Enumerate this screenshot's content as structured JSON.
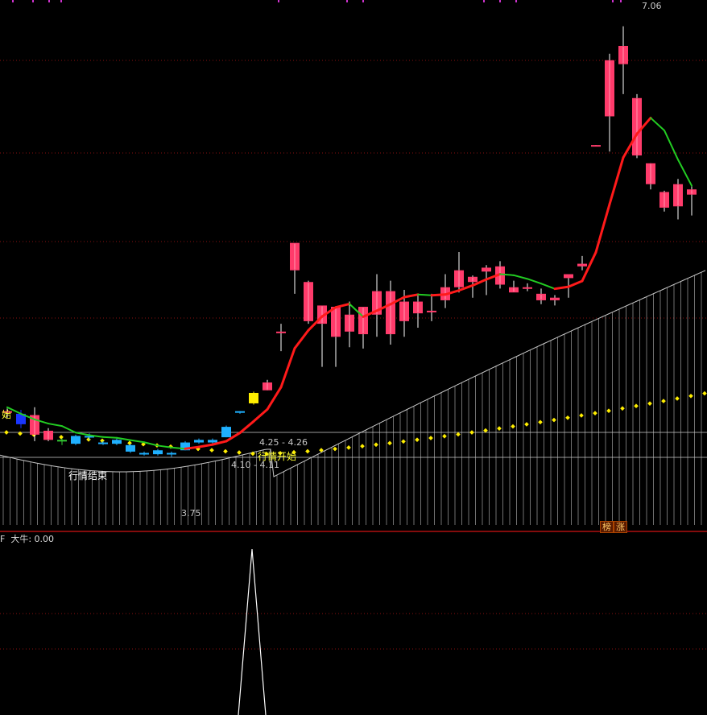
{
  "colors": {
    "background": "#000000",
    "grid": "#8a1010",
    "up_candle": "#ff3b6b",
    "down_candle": "#1fb0ff",
    "signal_up": "#ffee00",
    "signal_down": "#1a36ff",
    "green_candle": "#33cc33",
    "ma_rising": "#ff1a1a",
    "ma_falling": "#22cc22",
    "dots": "#ffee00",
    "envelope": "#c8c8c8",
    "indicator": "#ffffff"
  },
  "annotations": {
    "high_price": "7.06",
    "low_price": "3.75",
    "range_upper": "4.25 - 4.26",
    "range_lower": "4.10 - 4.11",
    "trend_end": "行情结束",
    "trend_start": "行情开始",
    "left_cut": "始",
    "badge_a": "榜",
    "badge_b": "涨"
  },
  "indicator": {
    "prefix": "F",
    "name": "大牛",
    "value": "0.00"
  },
  "chart_data": {
    "type": "candlestick",
    "ylim": [
      3.25,
      7.2
    ],
    "candles": [
      {
        "o": 4.1,
        "h": 4.13,
        "l": 4.06,
        "c": 4.11,
        "kind": "up"
      },
      {
        "o": 4.09,
        "h": 4.12,
        "l": 3.98,
        "c": 4.01,
        "kind": "signal_down"
      },
      {
        "o": 4.08,
        "h": 4.14,
        "l": 3.88,
        "c": 3.93,
        "kind": "up"
      },
      {
        "o": 3.96,
        "h": 3.98,
        "l": 3.88,
        "c": 3.89,
        "kind": "up"
      },
      {
        "o": 3.88,
        "h": 3.9,
        "l": 3.85,
        "c": 3.89,
        "kind": "green"
      },
      {
        "o": 3.92,
        "h": 3.93,
        "l": 3.85,
        "c": 3.86,
        "kind": "down"
      },
      {
        "o": 3.92,
        "h": 3.94,
        "l": 3.89,
        "c": 3.91,
        "kind": "down"
      },
      {
        "o": 3.87,
        "h": 3.88,
        "l": 3.85,
        "c": 3.86,
        "kind": "down"
      },
      {
        "o": 3.89,
        "h": 3.9,
        "l": 3.85,
        "c": 3.86,
        "kind": "down"
      },
      {
        "o": 3.85,
        "h": 3.86,
        "l": 3.79,
        "c": 3.8,
        "kind": "down"
      },
      {
        "o": 3.79,
        "h": 3.8,
        "l": 3.77,
        "c": 3.78,
        "kind": "down"
      },
      {
        "o": 3.81,
        "h": 3.82,
        "l": 3.77,
        "c": 3.78,
        "kind": "down"
      },
      {
        "o": 3.79,
        "h": 3.8,
        "l": 3.76,
        "c": 3.79,
        "kind": "down"
      },
      {
        "o": 3.87,
        "h": 3.88,
        "l": 3.81,
        "c": 3.81,
        "kind": "down"
      },
      {
        "o": 3.89,
        "h": 3.9,
        "l": 3.86,
        "c": 3.87,
        "kind": "down"
      },
      {
        "o": 3.89,
        "h": 3.9,
        "l": 3.85,
        "c": 3.87,
        "kind": "down"
      },
      {
        "o": 3.99,
        "h": 4.0,
        "l": 3.91,
        "c": 3.91,
        "kind": "down"
      },
      {
        "o": 4.1,
        "h": 4.11,
        "l": 4.09,
        "c": 4.11,
        "kind": "down"
      },
      {
        "o": 4.17,
        "h": 4.26,
        "l": 4.16,
        "c": 4.25,
        "kind": "signal_up"
      },
      {
        "o": 4.27,
        "h": 4.35,
        "l": 4.27,
        "c": 4.33,
        "kind": "up"
      },
      {
        "o": 4.71,
        "h": 4.78,
        "l": 4.57,
        "c": 4.72,
        "kind": "up"
      },
      {
        "o": 5.19,
        "h": 5.35,
        "l": 5.01,
        "c": 5.4,
        "kind": "up"
      },
      {
        "o": 5.1,
        "h": 5.11,
        "l": 4.78,
        "c": 4.8,
        "kind": "up"
      },
      {
        "o": 4.92,
        "h": 4.91,
        "l": 4.45,
        "c": 4.78,
        "kind": "up"
      },
      {
        "o": 4.91,
        "h": 4.9,
        "l": 4.45,
        "c": 4.68,
        "kind": "up"
      },
      {
        "o": 4.72,
        "h": 4.95,
        "l": 4.6,
        "c": 4.85,
        "kind": "up"
      },
      {
        "o": 4.7,
        "h": 4.8,
        "l": 4.59,
        "c": 4.91,
        "kind": "up"
      },
      {
        "o": 4.85,
        "h": 5.16,
        "l": 4.68,
        "c": 5.03,
        "kind": "up"
      },
      {
        "o": 4.7,
        "h": 5.11,
        "l": 4.62,
        "c": 5.03,
        "kind": "up"
      },
      {
        "o": 4.8,
        "h": 5.04,
        "l": 4.68,
        "c": 4.95,
        "kind": "up"
      },
      {
        "o": 4.86,
        "h": 5.01,
        "l": 4.75,
        "c": 4.95,
        "kind": "up"
      },
      {
        "o": 4.88,
        "h": 5.01,
        "l": 4.8,
        "c": 4.88,
        "kind": "up"
      },
      {
        "o": 4.96,
        "h": 5.16,
        "l": 4.9,
        "c": 5.06,
        "kind": "up"
      },
      {
        "o": 5.06,
        "h": 5.33,
        "l": 5.02,
        "c": 5.19,
        "kind": "up"
      },
      {
        "o": 5.1,
        "h": 5.15,
        "l": 4.98,
        "c": 5.14,
        "kind": "up"
      },
      {
        "o": 5.21,
        "h": 5.23,
        "l": 5.0,
        "c": 5.18,
        "kind": "up"
      },
      {
        "o": 5.22,
        "h": 5.26,
        "l": 5.05,
        "c": 5.08,
        "kind": "up"
      },
      {
        "o": 5.06,
        "h": 5.11,
        "l": 5.03,
        "c": 5.02,
        "kind": "up"
      },
      {
        "o": 5.06,
        "h": 5.09,
        "l": 5.03,
        "c": 5.05,
        "kind": "up"
      },
      {
        "o": 5.01,
        "h": 5.05,
        "l": 4.93,
        "c": 4.96,
        "kind": "up"
      },
      {
        "o": 4.96,
        "h": 5.0,
        "l": 4.92,
        "c": 4.98,
        "kind": "up"
      },
      {
        "o": 5.13,
        "h": 5.13,
        "l": 4.98,
        "c": 5.16,
        "kind": "up"
      },
      {
        "o": 5.22,
        "h": 5.3,
        "l": 5.19,
        "c": 5.24,
        "kind": "up"
      },
      {
        "o": 6.15,
        "h": 6.15,
        "l": 6.14,
        "c": 6.15,
        "kind": "up"
      },
      {
        "o": 6.37,
        "h": 6.85,
        "l": 6.1,
        "c": 6.8,
        "kind": "up"
      },
      {
        "o": 6.91,
        "h": 7.06,
        "l": 6.54,
        "c": 6.77,
        "kind": "up"
      },
      {
        "o": 6.51,
        "h": 6.54,
        "l": 6.05,
        "c": 6.07,
        "kind": "up"
      },
      {
        "o": 6.01,
        "h": 6.01,
        "l": 5.81,
        "c": 5.85,
        "kind": "up"
      },
      {
        "o": 5.79,
        "h": 5.8,
        "l": 5.64,
        "c": 5.67,
        "kind": "up"
      },
      {
        "o": 5.85,
        "h": 5.89,
        "l": 5.58,
        "c": 5.68,
        "kind": "up"
      },
      {
        "o": 5.81,
        "h": 5.84,
        "l": 5.61,
        "c": 5.77,
        "kind": "up"
      }
    ]
  }
}
